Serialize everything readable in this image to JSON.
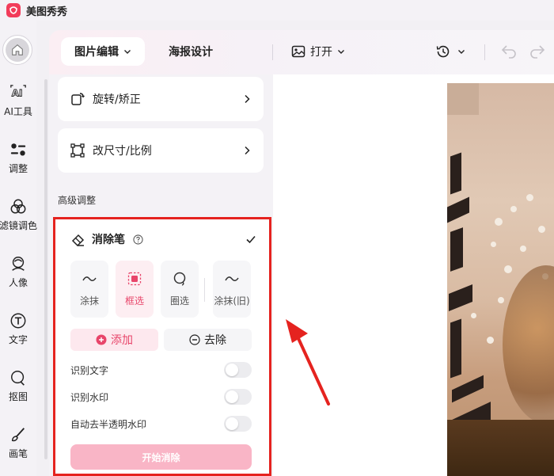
{
  "app": {
    "title": "美图秀秀",
    "brand_color": "#f23c5a"
  },
  "rail": {
    "items": [
      {
        "label": "AI工具",
        "icon": "ai-icon"
      },
      {
        "label": "调整",
        "icon": "adjust-icon"
      },
      {
        "label": "滤镜调色",
        "icon": "filter-icon"
      },
      {
        "label": "人像",
        "icon": "portrait-icon"
      },
      {
        "label": "文字",
        "icon": "text-icon"
      },
      {
        "label": "抠图",
        "icon": "cutout-icon"
      },
      {
        "label": "画笔",
        "icon": "brush-icon"
      }
    ]
  },
  "toolbar": {
    "tab_edit": "图片编辑",
    "tab_poster": "海报设计",
    "open_label": "打开"
  },
  "panel": {
    "rotate_label": "旋转/矫正",
    "resize_label": "改尺寸/比例",
    "advanced_title": "高级调整",
    "eraser": {
      "title": "消除笔",
      "modes": [
        {
          "label": "涂抹"
        },
        {
          "label": "框选"
        },
        {
          "label": "圈选"
        },
        {
          "label": "涂抹(旧)"
        }
      ],
      "add_label": "添加",
      "remove_label": "去除",
      "toggles": [
        {
          "label": "识别文字",
          "on": false
        },
        {
          "label": "识别水印",
          "on": false
        },
        {
          "label": "自动去半透明水印",
          "on": false
        }
      ],
      "start_label": "开始消除"
    }
  },
  "annotation": {
    "color": "#e5231f"
  }
}
